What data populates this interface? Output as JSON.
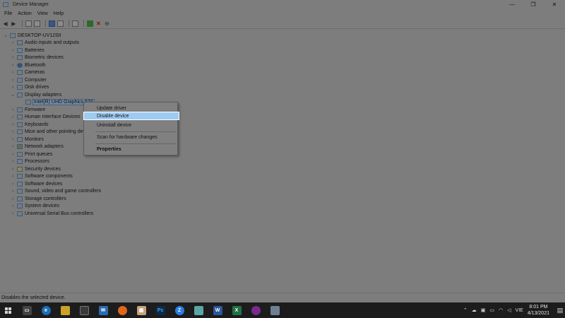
{
  "window": {
    "title": "Device Manager",
    "controls": [
      "—",
      "❐",
      "✕"
    ]
  },
  "menu": [
    "File",
    "Action",
    "View",
    "Help"
  ],
  "tree": {
    "root": "DESKTOP-UV12SII",
    "items": [
      {
        "label": "Audio inputs and outputs",
        "expanded": false
      },
      {
        "label": "Batteries",
        "expanded": false
      },
      {
        "label": "Biometric devices",
        "expanded": false
      },
      {
        "label": "Bluetooth",
        "expanded": false
      },
      {
        "label": "Cameras",
        "expanded": false
      },
      {
        "label": "Computer",
        "expanded": false
      },
      {
        "label": "Disk drives",
        "expanded": false
      },
      {
        "label": "Display adapters",
        "expanded": true
      },
      {
        "label": "Intel(R) UHD Graphics 620",
        "child": true,
        "selected": true
      },
      {
        "label": "Firmware",
        "expanded": false
      },
      {
        "label": "Human Interface Devices",
        "expanded": false
      },
      {
        "label": "Keyboards",
        "expanded": false
      },
      {
        "label": "Mice and other pointing devices",
        "expanded": false
      },
      {
        "label": "Monitors",
        "expanded": false
      },
      {
        "label": "Network adapters",
        "expanded": false
      },
      {
        "label": "Print queues",
        "expanded": false
      },
      {
        "label": "Processors",
        "expanded": false
      },
      {
        "label": "Security devices",
        "expanded": false
      },
      {
        "label": "Software components",
        "expanded": false
      },
      {
        "label": "Software devices",
        "expanded": false
      },
      {
        "label": "Sound, video and game controllers",
        "expanded": false
      },
      {
        "label": "Storage controllers",
        "expanded": false
      },
      {
        "label": "System devices",
        "expanded": false
      },
      {
        "label": "Universal Serial Bus controllers",
        "expanded": false
      }
    ]
  },
  "context_menu": {
    "update_driver": "Update driver",
    "disable_device": "Disable device",
    "uninstall_device": "Uninstall device",
    "scan": "Scan for hardware changes",
    "properties": "Properties"
  },
  "status": "Disables the selected device.",
  "taskbar": {
    "apps": [
      "task-view",
      "edge",
      "file-explorer",
      "store",
      "mail",
      "firefox",
      "app-grid",
      "photoshop",
      "zalo",
      "app",
      "word",
      "excel",
      "app",
      "app"
    ],
    "tray_lang": "VIE",
    "time": "8:01 PM",
    "date": "4/13/2021"
  },
  "colors": {
    "highlight": "#9fcbf2",
    "taskbar": "#1c1c1c"
  }
}
